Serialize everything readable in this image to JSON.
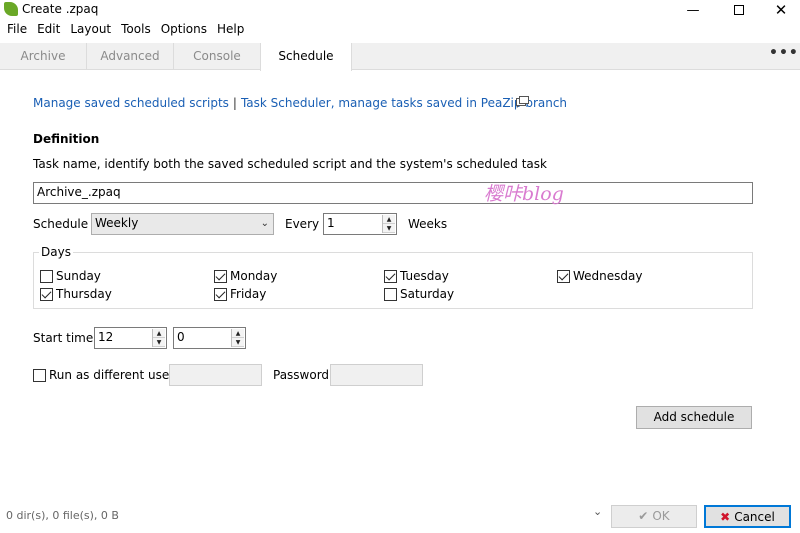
{
  "window": {
    "title": "Create .zpaq"
  },
  "menu": [
    "File",
    "Edit",
    "Layout",
    "Tools",
    "Options",
    "Help"
  ],
  "tabs": [
    "Archive",
    "Advanced",
    "Console",
    "Schedule"
  ],
  "links": {
    "manage_scripts": "Manage saved scheduled scripts",
    "separator": "|",
    "task_scheduler": "Task Scheduler, manage tasks saved in PeaZip branch"
  },
  "definition": {
    "heading": "Definition",
    "task_name_label": "Task name, identify both the saved scheduled script and the system's scheduled task",
    "task_name_value": "Archive_.zpaq",
    "watermark": "樱咔blog"
  },
  "schedule": {
    "label": "Schedule",
    "selected": "Weekly",
    "every_label": "Every",
    "every_value": "1",
    "unit": "Weeks"
  },
  "days": {
    "label": "Days",
    "items": [
      {
        "name": "Sunday",
        "checked": false
      },
      {
        "name": "Monday",
        "checked": true
      },
      {
        "name": "Tuesday",
        "checked": true
      },
      {
        "name": "Wednesday",
        "checked": true
      },
      {
        "name": "Thursday",
        "checked": true
      },
      {
        "name": "Friday",
        "checked": true
      },
      {
        "name": "Saturday",
        "checked": false
      }
    ]
  },
  "start_time": {
    "label": "Start time",
    "hour": "12",
    "minute": "0"
  },
  "run_as": {
    "label": "Run as different user",
    "checked": false,
    "password_label": "Password"
  },
  "buttons": {
    "add_schedule": "Add schedule",
    "ok": "OK",
    "cancel": "Cancel"
  },
  "status": {
    "text": "0 dir(s), 0 file(s), 0 B"
  },
  "colors": {
    "link": "#1a5fb4",
    "watermark": "#d97bd0",
    "accent": "#0078d7",
    "cancel_icon": "#d0142c"
  }
}
